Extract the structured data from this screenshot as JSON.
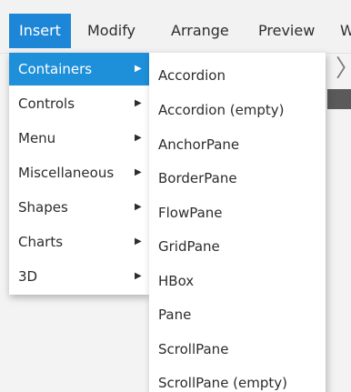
{
  "menubar": {
    "items": [
      {
        "label": "Insert",
        "active": true
      },
      {
        "label": "Modify",
        "active": false
      },
      {
        "label": "Arrange",
        "active": false
      },
      {
        "label": "Preview",
        "active": false
      },
      {
        "label": "W",
        "active": false
      }
    ]
  },
  "insert_menu": {
    "items": [
      {
        "label": "Containers",
        "has_submenu": true,
        "highlighted": true
      },
      {
        "label": "Controls",
        "has_submenu": true
      },
      {
        "label": "Menu",
        "has_submenu": true
      },
      {
        "label": "Miscellaneous",
        "has_submenu": true
      },
      {
        "label": "Shapes",
        "has_submenu": true
      },
      {
        "label": "Charts",
        "has_submenu": true
      },
      {
        "label": "3D",
        "has_submenu": true
      }
    ],
    "submenu_arrow_icon": "chevron-right-icon"
  },
  "containers_submenu": {
    "items": [
      "Accordion",
      "Accordion (empty)",
      "AnchorPane",
      "BorderPane",
      "FlowPane",
      "GridPane",
      "HBox",
      "Pane",
      "ScrollPane",
      "ScrollPane (empty)"
    ]
  },
  "colors": {
    "active_menu_bg": "#1e86d6",
    "highlight_bg": "#1e8fd9",
    "menu_bg": "#ffffff",
    "app_bg": "#f3f3f3"
  }
}
